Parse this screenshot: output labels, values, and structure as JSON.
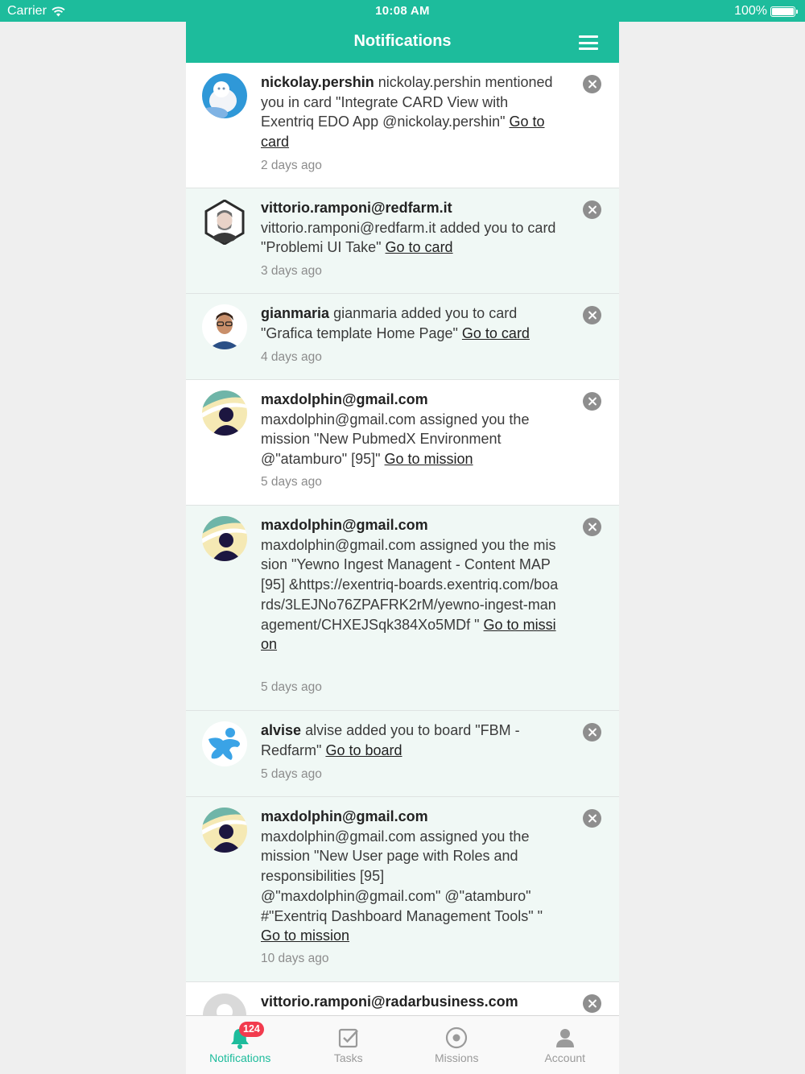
{
  "status_bar": {
    "carrier": "Carrier",
    "time": "10:08 AM",
    "battery": "100%"
  },
  "header": {
    "title": "Notifications"
  },
  "notifications": [
    {
      "user": "nickolay.pershin",
      "message": "nickolay.pershin mentioned you in card \"Integrate CARD View with Exentriq EDO App @nickolay.pershin\"",
      "link": "Go to card",
      "time": "2 days ago",
      "avatar": "cat-photo"
    },
    {
      "user": "vittorio.ramponi@redfarm.it",
      "message": "vittorio.ramponi@redfarm.it added you to card \"Problemi UI Take\"",
      "link": "Go to card",
      "time": "3 days ago",
      "avatar": "hexagon-portrait"
    },
    {
      "user": "gianmaria",
      "message": "gianmaria added you to card \"Grafica template Home Page\"",
      "link": "Go to card",
      "time": "4 days ago",
      "avatar": "man-glasses-photo"
    },
    {
      "user": "maxdolphin@gmail.com",
      "message": "maxdolphin@gmail.com assigned you the mission \"New PubmedX Environment @\"atamburo\" [95]\"",
      "link": "Go to mission",
      "time": "5 days ago",
      "avatar": "silhouette-photo"
    },
    {
      "user": "maxdolphin@gmail.com",
      "message": "maxdolphin@gmail.com assigned you the mission \"Yewno Ingest Managent - Content MAP [95] &https://exentriq-boards.exentriq.com/boards/3LEJNo76ZPAFRK2rM/yewno-ingest-management/CHXEJSqk384Xo5MDf \"",
      "link": "Go to mission",
      "time": "5 days ago",
      "avatar": "silhouette-photo"
    },
    {
      "user": "alvise",
      "message": "alvise added you to board \"FBM - Redfarm\"",
      "link": "Go to board",
      "time": "5 days ago",
      "avatar": "blue-figure-logo"
    },
    {
      "user": "maxdolphin@gmail.com",
      "message": "maxdolphin@gmail.com assigned you the mission \"New User page with Roles and responsibilities [95] @\"maxdolphin@gmail.com\" @\"atamburo\" #\"Exentriq Dashboard Management Tools\" \"",
      "link": "Go to mission",
      "time": "10 days ago",
      "avatar": "silhouette-photo"
    },
    {
      "user": "vittorio.ramponi@radarbusiness.com",
      "message": "",
      "link": "",
      "time": "",
      "avatar": "default-avatar"
    }
  ],
  "tabs": [
    {
      "label": "Notifications",
      "icon": "bell-icon",
      "badge": "124",
      "active": true
    },
    {
      "label": "Tasks",
      "icon": "checkbox-icon",
      "active": false
    },
    {
      "label": "Missions",
      "icon": "target-icon",
      "active": false
    },
    {
      "label": "Account",
      "icon": "person-icon",
      "active": false
    }
  ],
  "colors": {
    "accent": "#1dbc9c",
    "badge": "#f23b4e",
    "row_tint": "#f0f8f5"
  }
}
